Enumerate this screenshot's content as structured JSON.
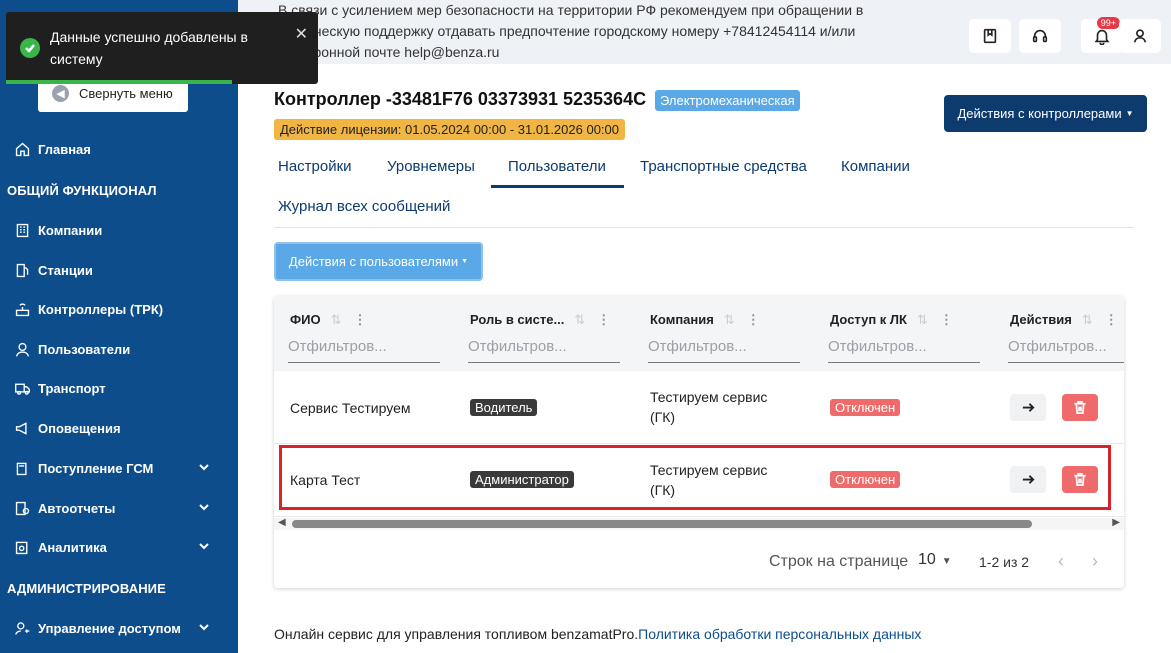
{
  "toast": {
    "message": "Данные успешно добавлены в систему",
    "close": "✕"
  },
  "sidebar": {
    "collapse_label": "Свернуть меню",
    "home": "Главная",
    "section_common": "ОБЩИЙ ФУНКЦИОНАЛ",
    "items": [
      {
        "label": "Компании",
        "icon": "building-icon"
      },
      {
        "label": "Станции",
        "icon": "fuel-station-icon"
      },
      {
        "label": "Контроллеры (ТРК)",
        "icon": "controller-icon"
      },
      {
        "label": "Пользователи",
        "icon": "user-icon"
      },
      {
        "label": "Транспорт",
        "icon": "truck-icon"
      },
      {
        "label": "Оповещения",
        "icon": "megaphone-icon"
      },
      {
        "label": "Поступление ГСМ",
        "icon": "fuel-icon"
      },
      {
        "label": "Автоотчеты",
        "icon": "report-icon"
      },
      {
        "label": "Аналитика",
        "icon": "analytics-icon"
      }
    ],
    "section_admin": "АДМИНИСТРИРОВАНИЕ",
    "access": "Управление доступом"
  },
  "topbar": {
    "notice": "В связи с усилением мер безопасности на территории РФ рекомендуем при обращении в техническую поддержку отдавать предпочтение городскому номеру +78412454114 и/или электронной почте help@benza.ru",
    "notifications_badge": "99+"
  },
  "controller": {
    "title": "Контроллер -33481F76 03373931 5235364C",
    "type": "Электромеханическая",
    "license": "Действие лицензии: 01.05.2024 00:00 - 31.01.2026 00:00",
    "actions_label": "Действия с контроллерами"
  },
  "tabs": [
    "Настройки",
    "Уровнемеры",
    "Пользователи",
    "Транспортные средства",
    "Компании",
    "Журнал всех сообщений"
  ],
  "users_actions_label": "Действия с пользователями",
  "table": {
    "columns": [
      "ФИО",
      "Роль в систе...",
      "Компания",
      "Доступ к ЛК",
      "Действия"
    ],
    "filter_placeholder": "Отфильтров...",
    "rows": [
      {
        "name": "Сервис Тестируем",
        "role": "Водитель",
        "company_line1": "Тестируем сервис",
        "company_line2": "(ГК)",
        "access": "Отключен"
      },
      {
        "name": "Карта Тест",
        "role": "Администратор",
        "company_line1": "Тестируем сервис",
        "company_line2": "(ГК)",
        "access": "Отключен"
      }
    ]
  },
  "pager": {
    "label": "Строк на странице",
    "per_page": "10",
    "range": "1-2 из 2"
  },
  "footer": {
    "text": "Онлайн сервис для управления топливом benzamatPro.",
    "link": "Политика обработки персональных данных"
  },
  "colors": {
    "sidebar": "#0d4d8c",
    "primary_dark": "#0d3b6e",
    "accent_blue": "#5aa9e6",
    "license_badge": "#f0b543",
    "danger": "#ef6b6b",
    "success": "#39b54a",
    "highlight_border": "#d8232a"
  }
}
